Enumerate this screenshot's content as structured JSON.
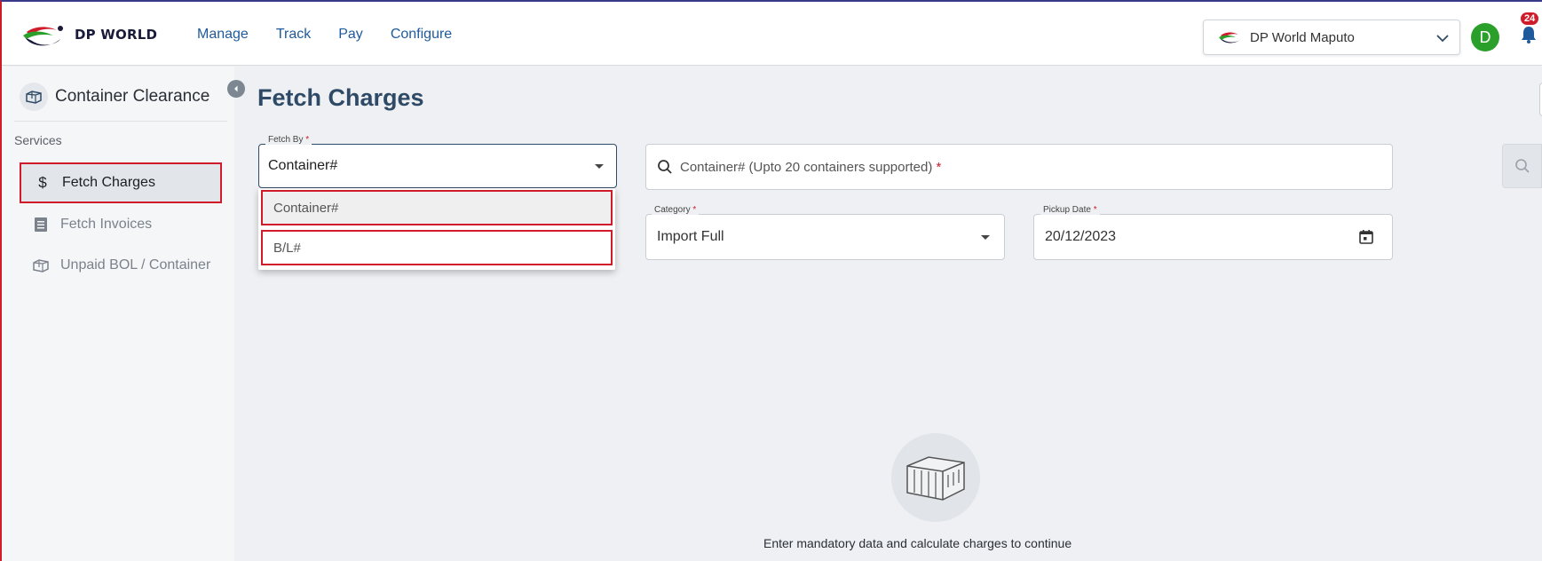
{
  "header": {
    "logo_text": "DP WORLD",
    "nav": [
      "Manage",
      "Track",
      "Pay",
      "Configure"
    ],
    "terminal": "DP World Maputo",
    "avatar_initial": "D",
    "notification_count": "24"
  },
  "sidebar": {
    "title": "Container Clearance",
    "section_label": "Services",
    "items": [
      {
        "label": "Fetch Charges",
        "icon": "dollar-icon"
      },
      {
        "label": "Fetch Invoices",
        "icon": "document-icon"
      },
      {
        "label": "Unpaid BOL / Container",
        "icon": "container-icon"
      }
    ]
  },
  "main": {
    "page_title": "Fetch Charges",
    "fetch_by": {
      "label": "Fetch By",
      "required_mark": "*",
      "value": "Container#",
      "options": [
        "Container#",
        "B/L#"
      ]
    },
    "search": {
      "placeholder": "Container# (Upto 20 containers supported)",
      "required_mark": "*"
    },
    "category": {
      "label": "Category",
      "required_mark": "*",
      "value": "Import Full"
    },
    "pickup_date": {
      "label": "Pickup Date",
      "required_mark": "*",
      "value": "20/12/2023"
    },
    "empty_message": "Enter mandatory data and calculate charges to continue"
  },
  "colors": {
    "accent_blue": "#1e5a9c",
    "title_blue": "#2f4a66",
    "highlight_red": "#d01c2a",
    "avatar_green": "#2aa02a"
  }
}
